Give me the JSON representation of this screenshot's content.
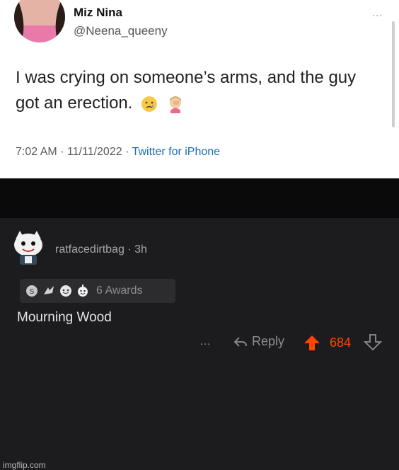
{
  "tweet": {
    "name": "Miz Nina",
    "handle": "@Neena_queeny",
    "more": "…",
    "text": "I was crying on someone’s arms, and the guy got an erection.",
    "time_date": "7:02 AM · 11/11/2022 · ",
    "source": "Twitter for iPhone",
    "emojis": [
      "crying-face-icon",
      "facepalm-icon"
    ]
  },
  "comment": {
    "username": "ratfacedirtbag",
    "age": " · 3h",
    "awards_label": "6 Awards",
    "award_icons": [
      "silver-award-icon",
      "hands-award-icon",
      "face-award-icon",
      "wholesome-award-icon"
    ],
    "body": "Mourning Wood",
    "more": "…",
    "reply_label": "Reply",
    "score": "684",
    "colors": {
      "upvote": "#ff4500",
      "meta": "#8e8e93",
      "body": "#e5e5ea"
    }
  },
  "watermark": "imgflip.com"
}
